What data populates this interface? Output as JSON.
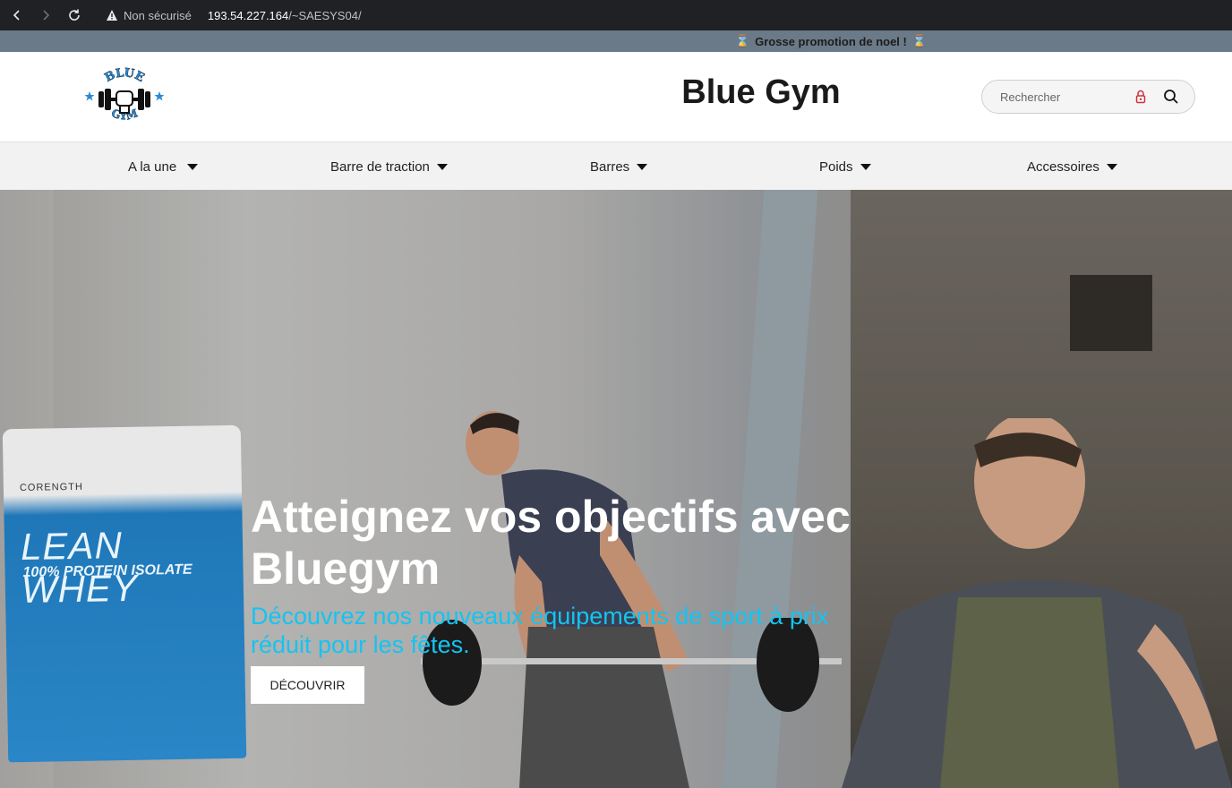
{
  "browser": {
    "security_label": "Non sécurisé",
    "url_host": "193.54.227.164",
    "url_path": "/~SAESYS04/"
  },
  "promo": {
    "icon": "hourglass-icon",
    "text": "Grosse promotion de noel !"
  },
  "header": {
    "logo_text_top": "BLUE",
    "logo_text_bottom": "GYM",
    "site_title": "Blue Gym",
    "search_placeholder": "Rechercher"
  },
  "menu": {
    "items": [
      {
        "label": "A la une"
      },
      {
        "label": "Barre de traction"
      },
      {
        "label": "Barres"
      },
      {
        "label": "Poids"
      },
      {
        "label": "Accessoires"
      }
    ]
  },
  "hero": {
    "title": "Atteignez vos objectifs avec Bluegym",
    "subtitle": "Découvrez nos nouveaux équipements de sport à prix réduit pour les fêtes.",
    "cta_label": "DÉCOUVRIR",
    "product_brand": "CORENGTH",
    "product_name": "LEAN WHEY",
    "product_sub": "100% PROTEIN ISOLATE"
  },
  "colors": {
    "promo_bar": "#6b7a88",
    "menu_bar": "#f2f2f2",
    "hero_subtitle": "#14c4f2",
    "logo_blue": "#2a8ad4"
  }
}
